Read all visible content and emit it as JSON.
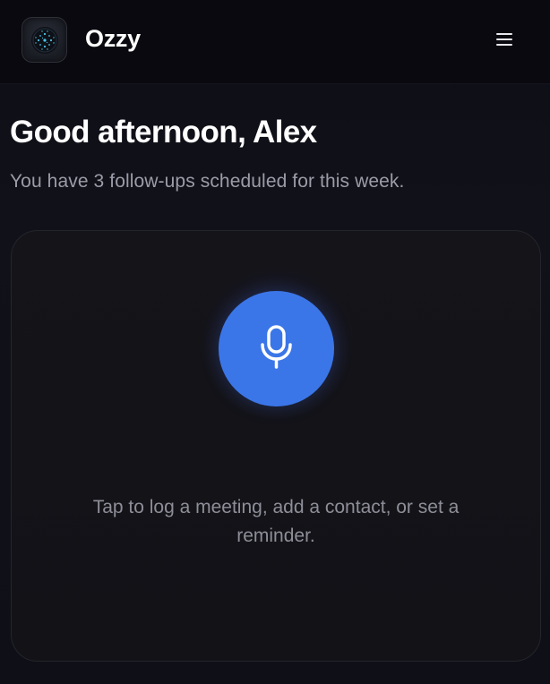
{
  "header": {
    "app_name": "Ozzy",
    "logo_icon": "ozzy-logo-icon",
    "menu_icon": "hamburger-menu-icon"
  },
  "main": {
    "greeting": "Good afternoon, Alex",
    "subtitle": "You have 3 follow-ups scheduled for this week."
  },
  "voice_card": {
    "mic_icon": "microphone-icon",
    "hint": "Tap to log a meeting, add a contact, or set a reminder.",
    "accent_color": "#3b76e8"
  }
}
